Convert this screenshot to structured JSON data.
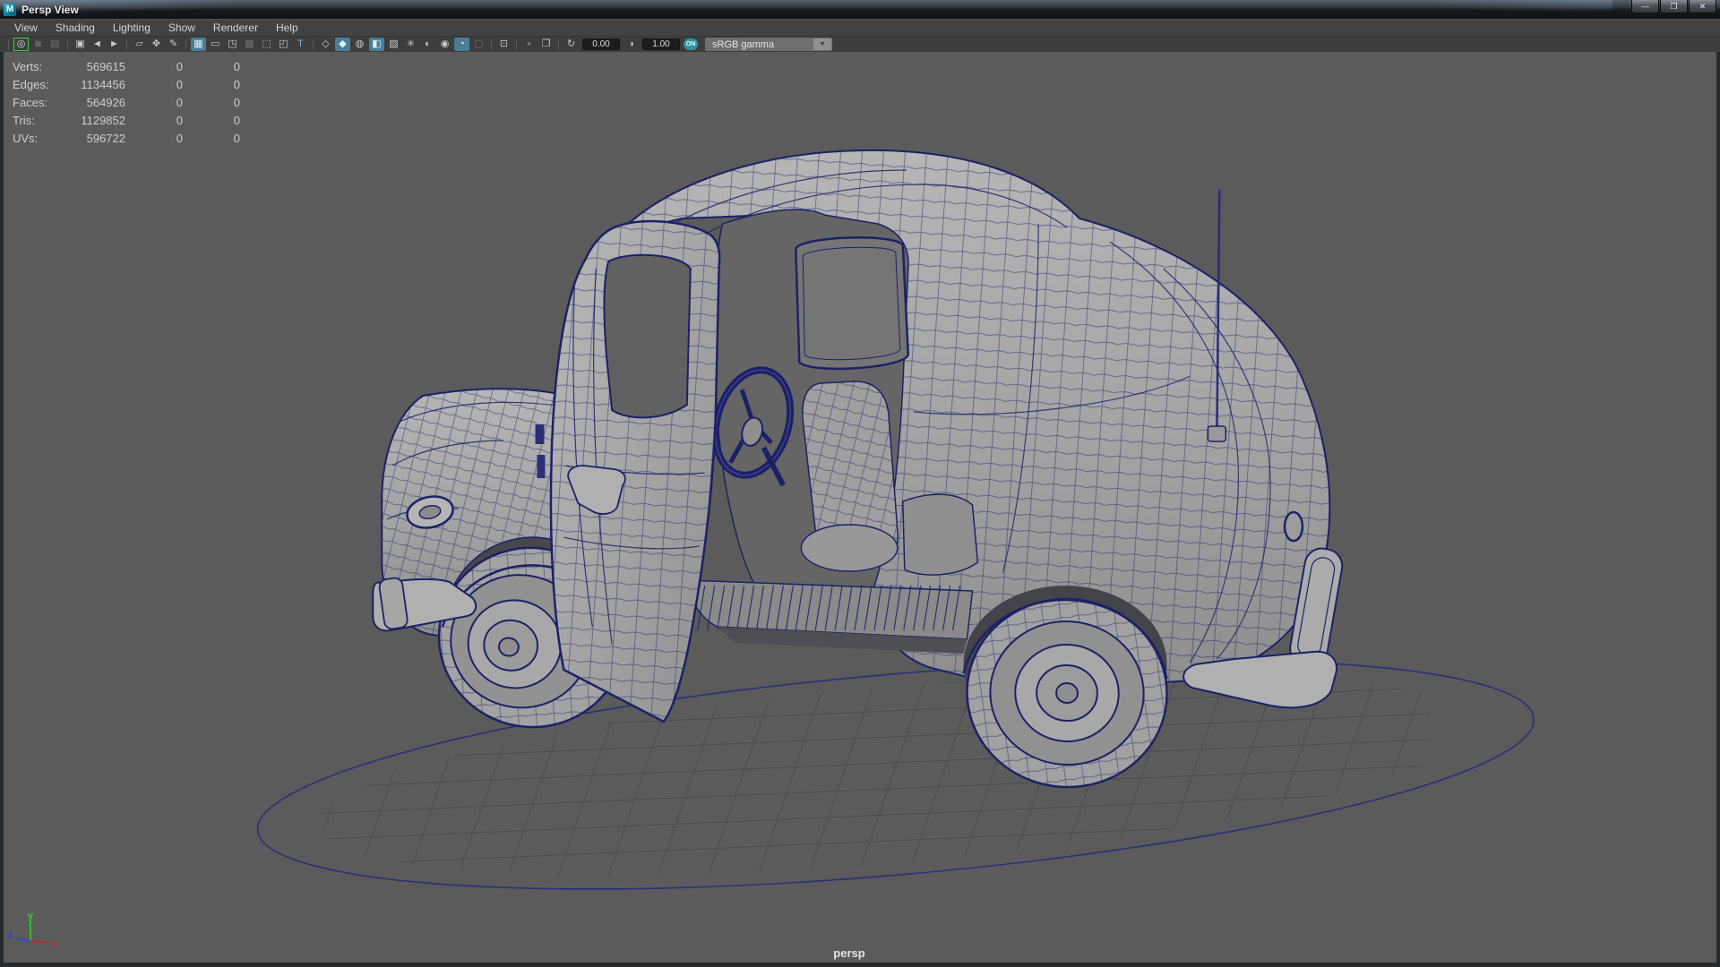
{
  "window": {
    "title": "Persp View",
    "icon_letter": "M",
    "controls": [
      {
        "name": "minimize-button",
        "glyph": "—"
      },
      {
        "name": "restore-button",
        "glyph": "❐"
      },
      {
        "name": "close-button",
        "glyph": "✕"
      }
    ]
  },
  "menu": {
    "items": [
      "View",
      "Shading",
      "Lighting",
      "Show",
      "Renderer",
      "Help"
    ]
  },
  "toolbar": {
    "icons": [
      {
        "type": "sep"
      },
      {
        "name": "select-camera",
        "glyph": "◎",
        "state": "selected"
      },
      {
        "name": "lock-camera",
        "glyph": "◙",
        "state": "dim"
      },
      {
        "name": "camera-attributes",
        "glyph": "▤",
        "state": "dim"
      },
      {
        "type": "sep"
      },
      {
        "name": "bookmark-view",
        "glyph": "▣",
        "state": ""
      },
      {
        "name": "previous-view",
        "glyph": "◄",
        "state": ""
      },
      {
        "name": "next-view",
        "glyph": "►",
        "state": ""
      },
      {
        "type": "sep"
      },
      {
        "name": "image-plane",
        "glyph": "▱",
        "state": ""
      },
      {
        "name": "2d-pan-zoom",
        "glyph": "✥",
        "state": ""
      },
      {
        "name": "grease-pencil",
        "glyph": "✎",
        "state": ""
      },
      {
        "type": "sep"
      },
      {
        "name": "grid-toggle",
        "glyph": "▦",
        "state": "active"
      },
      {
        "name": "film-gate",
        "glyph": "▭",
        "state": ""
      },
      {
        "name": "resolution-gate",
        "glyph": "◳",
        "state": ""
      },
      {
        "name": "gate-mask",
        "glyph": "▩",
        "state": "dim"
      },
      {
        "name": "field-chart",
        "glyph": "⬚",
        "state": ""
      },
      {
        "name": "safe-action",
        "glyph": "◰",
        "state": ""
      },
      {
        "name": "safe-title",
        "glyph": "T",
        "state": "blue"
      },
      {
        "type": "sep"
      },
      {
        "name": "wireframe-mode",
        "glyph": "◇",
        "state": ""
      },
      {
        "name": "smooth-shade-mode",
        "glyph": "◆",
        "state": "active"
      },
      {
        "name": "textured-sphere",
        "glyph": "◍",
        "state": ""
      },
      {
        "name": "textured-mode",
        "glyph": "◧",
        "state": "active"
      },
      {
        "name": "use-default-material",
        "glyph": "▨",
        "state": ""
      },
      {
        "name": "lighting-toggle",
        "glyph": "✳",
        "state": ""
      },
      {
        "name": "shadows-toggle",
        "glyph": "◐",
        "state": ""
      },
      {
        "name": "ssao-toggle",
        "glyph": "◉",
        "state": ""
      },
      {
        "name": "motion-blur-toggle",
        "glyph": "◔",
        "state": "active"
      },
      {
        "name": "multisample-toggle",
        "glyph": "▢",
        "state": "dim"
      },
      {
        "type": "sep"
      },
      {
        "name": "isolate-select",
        "glyph": "⊡",
        "state": ""
      },
      {
        "type": "sep"
      },
      {
        "name": "object-details",
        "glyph": "▫",
        "state": ""
      },
      {
        "name": "snapshot",
        "glyph": "❐",
        "state": ""
      },
      {
        "type": "sep"
      },
      {
        "name": "exposure",
        "glyph": "↻",
        "state": ""
      },
      {
        "type": "field",
        "name": "exposure-value",
        "bind": "toolbar.exposure_value"
      },
      {
        "name": "contrast",
        "glyph": "◑",
        "state": ""
      },
      {
        "type": "field",
        "name": "gamma-value",
        "bind": "toolbar.gamma_value"
      },
      {
        "name": "color-management-on",
        "glyph": "ON",
        "state": "on"
      }
    ],
    "exposure_value": "0.00",
    "gamma_value": "1.00",
    "colorspace": "sRGB gamma",
    "dropdown_arrow": "▼"
  },
  "hud": {
    "rows": [
      {
        "label": "Verts:",
        "v1": "569615",
        "v2": "0",
        "v3": "0"
      },
      {
        "label": "Edges:",
        "v1": "1134456",
        "v2": "0",
        "v3": "0"
      },
      {
        "label": "Faces:",
        "v1": "564926",
        "v2": "0",
        "v3": "0"
      },
      {
        "label": "Tris:",
        "v1": "1129852",
        "v2": "0",
        "v3": "0"
      },
      {
        "label": "UVs:",
        "v1": "596722",
        "v2": "0",
        "v3": "0"
      }
    ]
  },
  "viewport": {
    "camera_label": "persp",
    "axis": {
      "x": "x",
      "y": "y",
      "z": "z"
    }
  },
  "colors": {
    "viewport_bg": "#5b5b5b",
    "wireframe": "#1c2166",
    "grid_line": "#4b4b4b",
    "disc_line": "#2b2f7a",
    "active_icon_bg": "#4a7d95",
    "selection_green": "#3fd13f",
    "axis_x": "#cc2020",
    "axis_y": "#30d030",
    "axis_z": "#2040ee"
  }
}
